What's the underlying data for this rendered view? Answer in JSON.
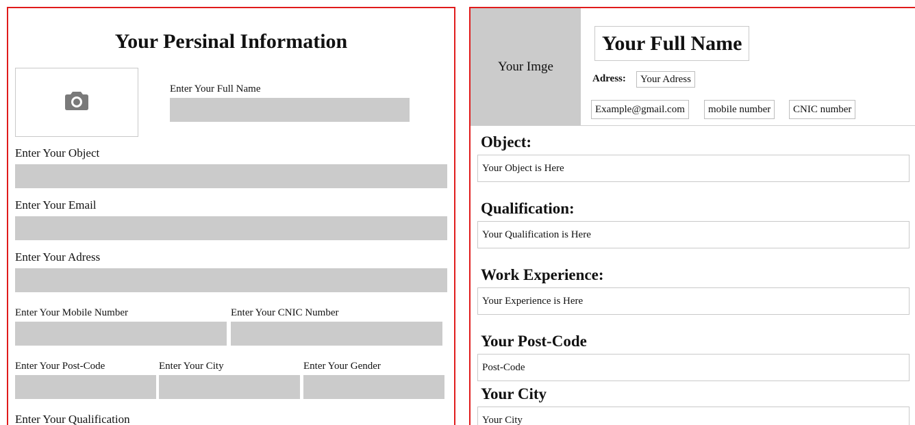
{
  "form": {
    "title": "Your Persinal Information",
    "photo_icon": "camera-icon",
    "labels": {
      "full_name": "Enter Your Full Name",
      "object": "Enter Your Object",
      "email": "Enter Your Email",
      "adress": "Enter Your Adress",
      "mobile": "Enter Your Mobile Number",
      "cnic": "Enter Your CNIC Number",
      "post_code": "Enter Your Post-Code",
      "city": "Enter Your City",
      "gender": "Enter Your Gender",
      "qualification": "Enter Your Qualification"
    },
    "values": {
      "full_name": "",
      "object": "",
      "email": "",
      "adress": "",
      "mobile": "",
      "cnic": "",
      "post_code": "",
      "city": "",
      "gender": ""
    }
  },
  "cv": {
    "image_placeholder": "Your Imge",
    "name": "Your Full Name",
    "adress_label": "Adress:",
    "adress": "Your Adress",
    "email": "Example@gmail.com",
    "mobile": "mobile number",
    "cnic": "CNIC number",
    "sections": [
      {
        "title": "Object:",
        "content": "Your Object is Here"
      },
      {
        "title": "Qualification:",
        "content": "Your Qualification is Here"
      },
      {
        "title": "Work Experience:",
        "content": "Your Experience is Here"
      },
      {
        "title": "Your Post-Code",
        "content": "Post-Code"
      },
      {
        "title": "Your City",
        "content": "Your City"
      }
    ]
  },
  "colors": {
    "panel_border": "#e01b1b",
    "field_background": "#cbcbcb",
    "camera_icon": "#7a7a7a"
  }
}
